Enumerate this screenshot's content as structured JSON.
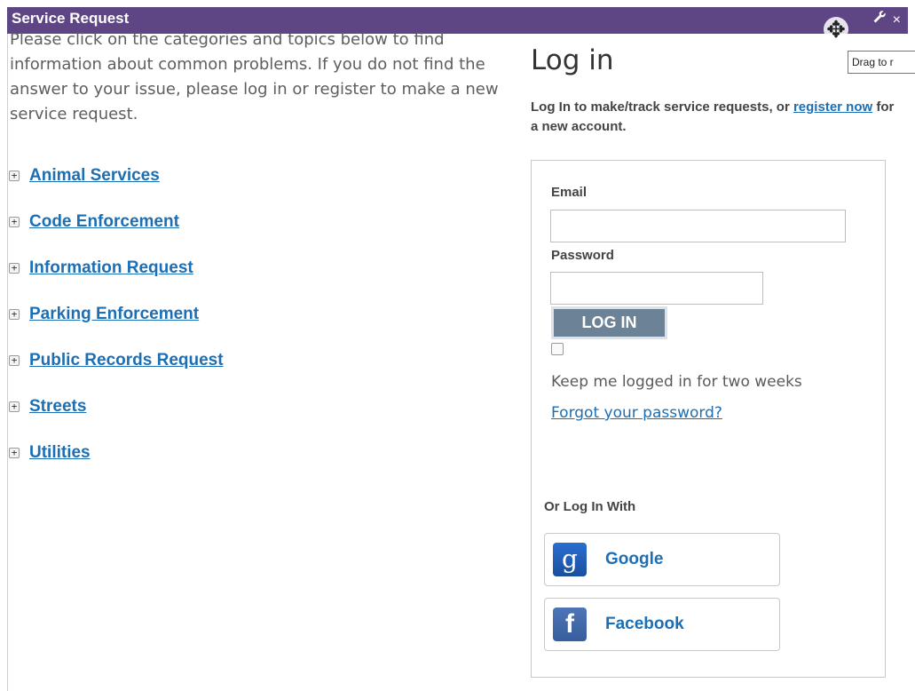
{
  "window": {
    "title": "Service Request",
    "tools": {
      "wrench_icon": "wrench-icon",
      "close_icon": "close-icon",
      "close_glyph": "×"
    },
    "tooltip": "Drag to r"
  },
  "intro": "Please click on the categories and topics below to find information about common problems. If you do not find the answer to your issue, please log in or register to make a new service request.",
  "categories": [
    {
      "label": "Animal Services"
    },
    {
      "label": "Code Enforcement"
    },
    {
      "label": "Information Request"
    },
    {
      "label": "Parking Enforcement"
    },
    {
      "label": "Public Records Request"
    },
    {
      "label": "Streets"
    },
    {
      "label": "Utilities"
    }
  ],
  "login": {
    "heading": "Log in",
    "sub_prefix": "Log In to make/track service requests, or",
    "register_link": "register now",
    "sub_suffix": "for a new account.",
    "email_label": "Email",
    "email_value": "",
    "password_label": "Password",
    "password_value": "",
    "button": "LOG IN",
    "remember_checked": false,
    "remember_label": "Keep me logged in for two weeks",
    "forgot": "Forgot your password?",
    "or_label": "Or Log In With",
    "providers": [
      {
        "name": "Google",
        "icon": "google-icon",
        "glyph": "g"
      },
      {
        "name": "Facebook",
        "icon": "facebook-icon",
        "glyph": "f"
      }
    ]
  },
  "colors": {
    "titlebar": "#5e4685",
    "link": "#1c6fb4",
    "button": "#6c8297"
  }
}
